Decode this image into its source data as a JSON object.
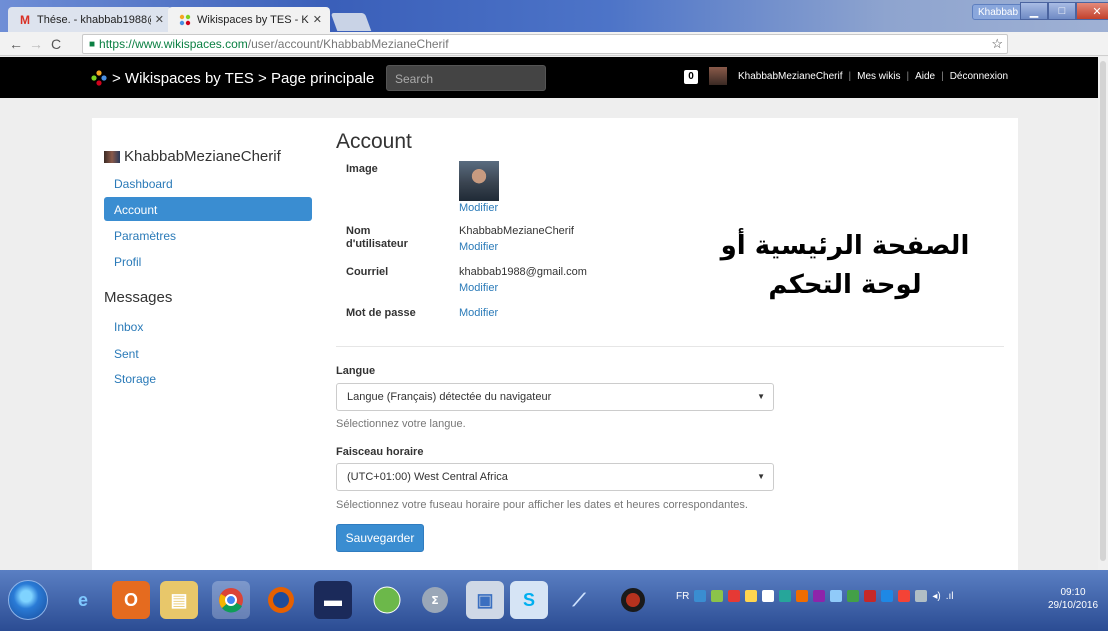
{
  "browser": {
    "tabs": [
      {
        "title": "Thése. - khabbab1988@",
        "icon": "gmail-icon",
        "active": false
      },
      {
        "title": "Wikispaces by TES - Khal",
        "icon": "wikispaces-icon",
        "active": true
      }
    ],
    "window_user": "Khabbab",
    "url_host": "https://www.wikispaces.com",
    "url_path": "/user/account/KhabbabMezianeCherif"
  },
  "site": {
    "breadcrumb": "> Wikispaces by TES > Page principale",
    "search_placeholder": "Search",
    "notification_count": "0",
    "username": "KhabbabMezianeCherif",
    "links": [
      "Mes wikis",
      "Aide",
      "Déconnexion"
    ]
  },
  "sidebar": {
    "username": "KhabbabMezianeCherif",
    "items": [
      {
        "label": "Dashboard",
        "active": false
      },
      {
        "label": "Account",
        "active": true
      },
      {
        "label": "Paramètres",
        "active": false
      },
      {
        "label": "Profil",
        "active": false
      }
    ],
    "messages_heading": "Messages",
    "message_items": [
      {
        "label": "Inbox"
      },
      {
        "label": "Sent"
      },
      {
        "label": "Storage"
      }
    ]
  },
  "account": {
    "title": "Account",
    "image_label": "Image",
    "modify": "Modifier",
    "username_label_1": "Nom",
    "username_label_2": "d'utilisateur",
    "username_value": "KhabbabMezianeCherif",
    "email_label": "Courriel",
    "email_value": "khabbab1988@gmail.com",
    "password_label": "Mot de passe"
  },
  "settings": {
    "language_label": "Langue",
    "language_value": "Langue (Français) détectée du navigateur",
    "language_help": "Sélectionnez votre langue.",
    "timezone_label": "Faisceau horaire",
    "timezone_value": "(UTC+01:00) West Central Africa",
    "timezone_help": "Sélectionnez votre fuseau horaire pour afficher les dates et heures correspondantes.",
    "save_label": "Sauvegarder"
  },
  "overlay_text": {
    "line1": "الصفحة الرئيسية أو",
    "line2": "لوحة التحكم"
  },
  "taskbar": {
    "language": "FR",
    "time": "09:10",
    "date": "29/10/2016"
  }
}
